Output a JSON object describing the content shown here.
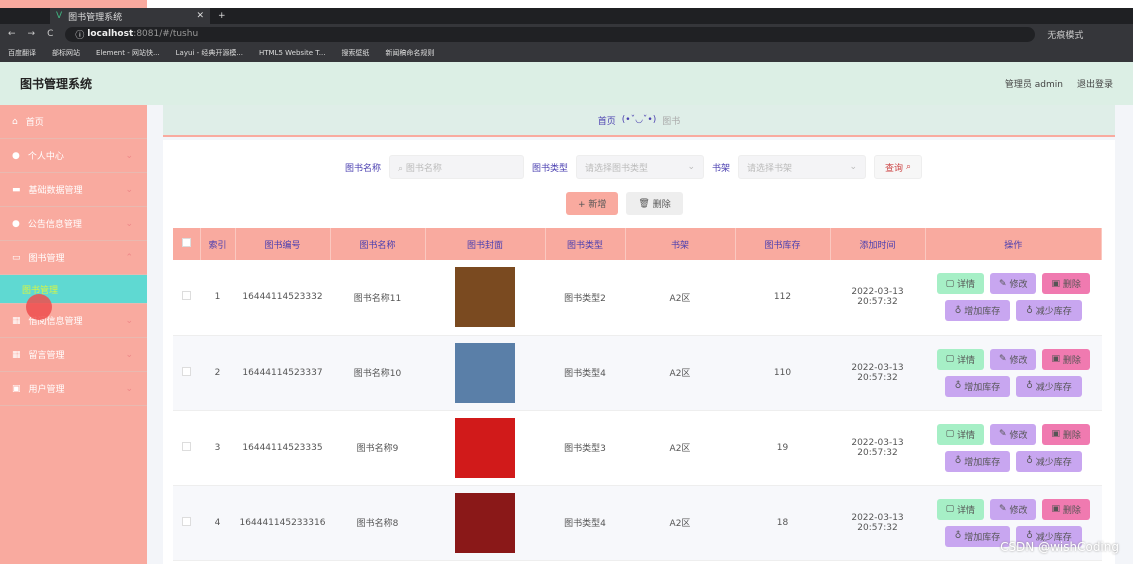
{
  "browser": {
    "tab_title": "图书管理系统",
    "url_host": "localhost",
    "url_rest": ":8081/#/tushu",
    "incognito": "无痕模式",
    "bookmarks": [
      "百度翻译",
      "部标网站",
      "Element - 网站快...",
      "Layui - 经典开源模...",
      "HTML5 Website T...",
      "搜索壁纸",
      "新闻稿命名规则"
    ]
  },
  "header": {
    "title": "图书管理系统",
    "user": "管理员 admin",
    "logout": "退出登录"
  },
  "sidebar": {
    "items": [
      "首页",
      "个人中心",
      "基础数据管理",
      "公告信息管理",
      "图书管理"
    ],
    "sub": "图书管理",
    "items2": [
      "借阅信息管理",
      "留言管理",
      "用户管理"
    ]
  },
  "breadcrumb": {
    "home": "首页",
    "face": "(•ˇ◡ˇ•)",
    "current": "图书"
  },
  "search": {
    "name_label": "图书名称",
    "name_ph": "图书名称",
    "type_label": "图书类型",
    "type_ph": "请选择图书类型",
    "shelf_label": "书架",
    "shelf_ph": "请选择书架",
    "query": "查询"
  },
  "actions": {
    "add": "+ 新增",
    "delete": "删除"
  },
  "table": {
    "headers": [
      "索引",
      "图书编号",
      "图书名称",
      "图书封面",
      "图书类型",
      "书架",
      "图书库存",
      "添加时间",
      "操作"
    ],
    "rows": [
      {
        "idx": "1",
        "code": "16444114523332",
        "name": "图书名称11",
        "type": "图书类型2",
        "shelf": "A2区",
        "stock": "112",
        "time": "2022-03-13 20:57:32",
        "color": "#7a4a20"
      },
      {
        "idx": "2",
        "code": "16444114523337",
        "name": "图书名称10",
        "type": "图书类型4",
        "shelf": "A2区",
        "stock": "110",
        "time": "2022-03-13 20:57:32",
        "color": "#5a7fa8"
      },
      {
        "idx": "3",
        "code": "16444114523335",
        "name": "图书名称9",
        "type": "图书类型3",
        "shelf": "A2区",
        "stock": "19",
        "time": "2022-03-13 20:57:32",
        "color": "#d11a1a"
      },
      {
        "idx": "4",
        "code": "164441145233316",
        "name": "图书名称8",
        "type": "图书类型4",
        "shelf": "A2区",
        "stock": "18",
        "time": "2022-03-13 20:57:32",
        "color": "#8a1818"
      }
    ],
    "ops": [
      "详情",
      "修改",
      "删除",
      "增加库存",
      "减少库存"
    ]
  },
  "watermark": "CSDN @wishCoding"
}
